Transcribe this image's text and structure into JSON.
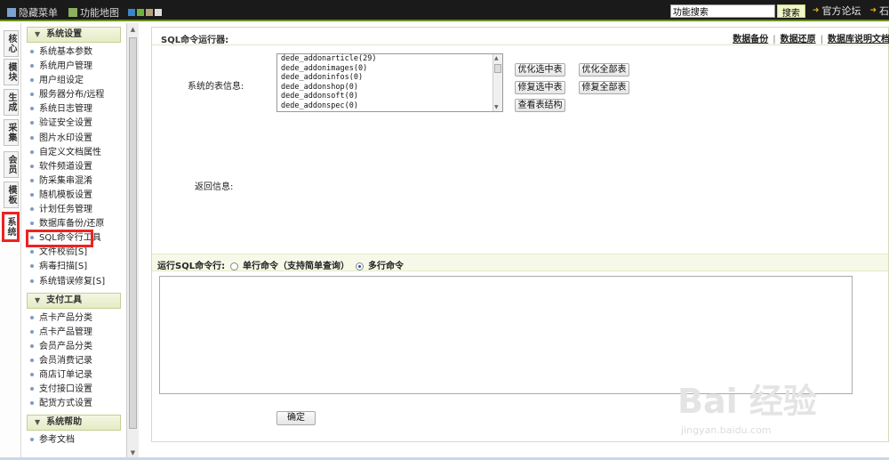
{
  "topbar": {
    "hide_menu": "隐藏菜单",
    "site_map": "功能地图",
    "search_value": "功能搜索",
    "search_button": "搜索",
    "forum": "官方论坛",
    "overflow": "石",
    "theme_colors": [
      "#3a86c8",
      "#6fb33c",
      "#b8a27a",
      "#dddddd"
    ]
  },
  "modules": [
    "核心",
    "模块",
    "生成",
    "采集",
    "会员",
    "模板",
    "系统"
  ],
  "sidebar": {
    "sections": [
      {
        "title": "系统设置",
        "items": [
          "系统基本参数",
          "系统用户管理",
          "用户组设定",
          "服务器分布/远程",
          "系统日志管理",
          "验证安全设置",
          "图片水印设置",
          "自定义文档属性",
          "软件频道设置",
          "防采集串混淆",
          "随机模板设置",
          "计划任务管理",
          "数据库备份/还原",
          "SQL命令行工具",
          "文件校验[S]",
          "病毒扫描[S]",
          "系统错误修复[S]"
        ]
      },
      {
        "title": "支付工具",
        "items": [
          "点卡产品分类",
          "点卡产品管理",
          "会员产品分类",
          "会员消费记录",
          "商店订单记录",
          "支付接口设置",
          "配货方式设置"
        ]
      },
      {
        "title": "系统帮助",
        "items": [
          "参考文档"
        ]
      }
    ]
  },
  "main": {
    "title": "SQL命令运行器:",
    "links": [
      "数据备份",
      "数据还原",
      "数据库说明文档"
    ],
    "table_info_label": "系统的表信息:",
    "tables": [
      "dede_addonarticle(29)",
      "dede_addonimages(0)",
      "dede_addoninfos(0)",
      "dede_addonshop(0)",
      "dede_addonsoft(0)",
      "dede_addonspec(0)"
    ],
    "buttons": {
      "optimize_selected": "优化选中表",
      "optimize_all": "优化全部表",
      "repair_selected": "修复选中表",
      "repair_all": "修复全部表",
      "view_structure": "查看表结构"
    },
    "return_label": "返回信息:",
    "run_label": "运行SQL命令行:",
    "mode_single": "单行命令（支持简单查询）",
    "mode_multi": "多行命令",
    "selected_mode": "多行命令",
    "sql_value": "",
    "confirm": "确定"
  },
  "watermark": {
    "brand": "Bai 经验",
    "url": "jingyan.baidu.com"
  }
}
